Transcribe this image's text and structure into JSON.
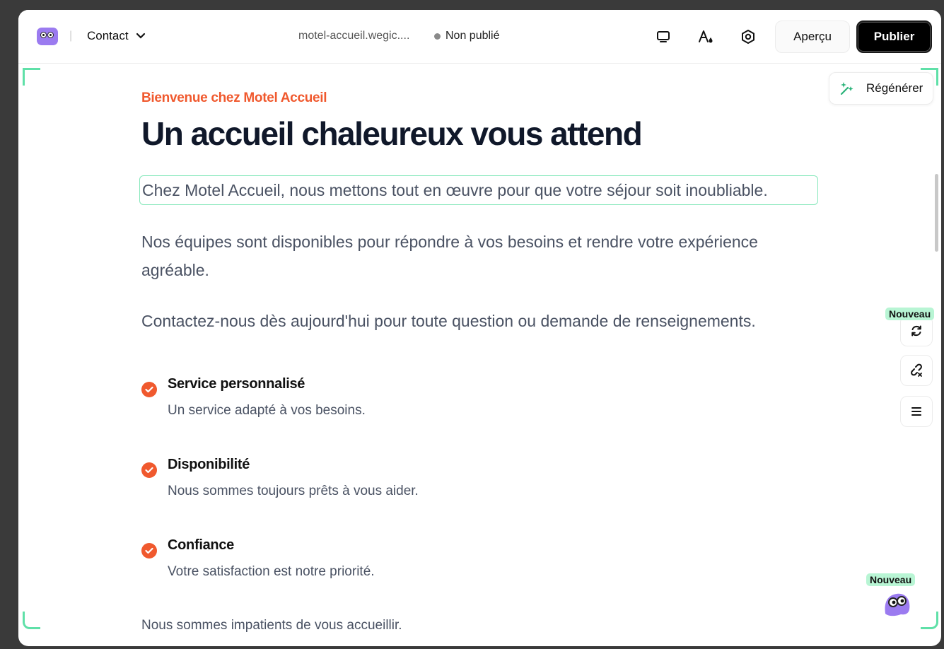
{
  "topbar": {
    "page_selector": "Contact",
    "url": "motel-accueil.wegic....",
    "status": "Non publié",
    "preview_label": "Aperçu",
    "publish_label": "Publier",
    "tools": [
      "desktop-icon",
      "typography-color-icon",
      "settings-icon"
    ]
  },
  "content": {
    "eyebrow": "Bienvenue chez Motel Accueil",
    "headline": "Un accueil chaleureux vous attend",
    "paragraphs": [
      "Chez Motel Accueil, nous mettons tout en œuvre pour que votre séjour soit inoubliable.",
      "Nos équipes sont disponibles pour répondre à vos besoins et rendre votre expérience agréable.",
      "Contactez-nous dès aujourd'hui pour toute question ou demande de renseignements."
    ],
    "features": [
      {
        "title": "Service personnalisé",
        "description": "Un service adapté à vos besoins."
      },
      {
        "title": "Disponibilité",
        "description": "Nous sommes toujours prêts à vous aider."
      },
      {
        "title": "Confiance",
        "description": "Votre satisfaction est notre priorité."
      }
    ],
    "closing": "Nous sommes impatients de vous accueillir."
  },
  "side_panel": {
    "regenerate_label": "Régénérer",
    "new_badge": "Nouveau",
    "tools": [
      "sync-icon",
      "unlink-icon",
      "menu-icon"
    ]
  },
  "colors": {
    "accent": "#f0592e",
    "selection": "#5fe0a8",
    "heading": "#10182a",
    "publish_bg": "#000000"
  }
}
